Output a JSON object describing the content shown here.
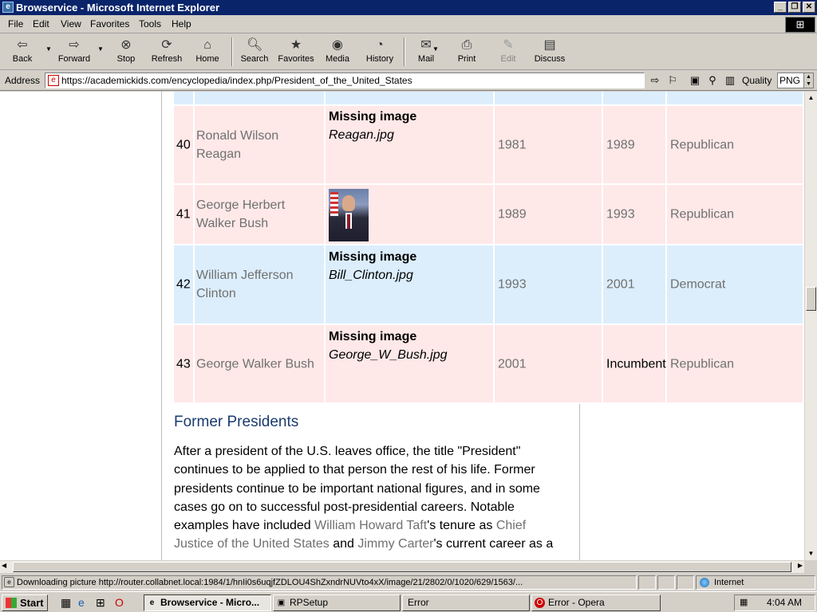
{
  "window": {
    "title": "Browservice - Microsoft Internet Explorer",
    "buttons": [
      "_",
      "❐",
      "✕"
    ]
  },
  "menu": [
    "File",
    "Edit",
    "View",
    "Favorites",
    "Tools",
    "Help"
  ],
  "toolbar": {
    "back": "Back",
    "forward": "Forward",
    "stop": "Stop",
    "refresh": "Refresh",
    "home": "Home",
    "search": "Search",
    "favorites": "Favorites",
    "media": "Media",
    "history": "History",
    "mail": "Mail",
    "print": "Print",
    "edit": "Edit",
    "discuss": "Discuss"
  },
  "address": {
    "label": "Address",
    "url": "https://academickids.com/encyclopedia/index.php/President_of_the_United_States"
  },
  "quality": {
    "label": "Quality",
    "value": "PNG"
  },
  "table": {
    "rows": [
      {
        "num": "40",
        "name_line1": "Ronald Wilson",
        "name_line2": "Reagan",
        "img_title": "Missing image",
        "img_file": "Reagan.jpg",
        "start": "1981",
        "end": "1989",
        "party": "Republican"
      },
      {
        "num": "41",
        "name_line1": "George Herbert",
        "name_line2": "Walker Bush",
        "start": "1989",
        "end": "1993",
        "party": "Republican"
      },
      {
        "num": "42",
        "name_line1": "William Jefferson",
        "name_line2": "Clinton",
        "img_title": "Missing image",
        "img_file": "Bill_Clinton.jpg",
        "start": "1993",
        "end": "2001",
        "party": "Democrat"
      },
      {
        "num": "43",
        "name_line1": "George Walker Bush",
        "img_title": "Missing image",
        "img_file": "George_W_Bush.jpg",
        "start": "2001",
        "end": "Incumbent",
        "party": "Republican"
      }
    ]
  },
  "article": {
    "heading": "Former Presidents",
    "t1": "After a president of the U.S. leaves office, the title \"President\" continues to be applied to that person the rest of his life. Former presidents continue to be important national figures, and in some cases go on to successful post-presidential careers. Notable examples have included ",
    "link1": "William Howard Taft",
    "t2": "'s tenure as ",
    "link2": "Chief Justice of the United States",
    "t3": " and ",
    "link3": "Jimmy Carter",
    "t4": "'s current career as a"
  },
  "status": {
    "text": "Downloading picture http://router.collabnet.local:1984/1/hnIi0s6uqjfZDLOU4ShZxndrNUVto4xX/image/21/2802/0/1020/629/1563/...",
    "zone": "Internet"
  },
  "taskbar": {
    "start": "Start",
    "tasks": [
      "Browservice - Micro...",
      "RPSetup",
      "Error",
      "Error - Opera"
    ],
    "clock": "4:04 AM"
  }
}
